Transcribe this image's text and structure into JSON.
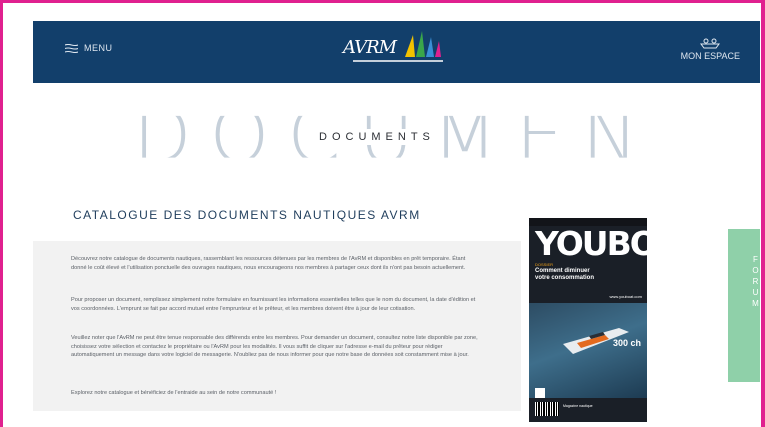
{
  "header": {
    "menu_label": "MENU",
    "logo_text": "AVRM",
    "myspace_label": "MON ESPACE",
    "logo_colors": [
      "#f2c200",
      "#3aa64a",
      "#e0208f",
      "#3a8fd6"
    ]
  },
  "hero": {
    "big_text": "DOCUMENTS",
    "small_text": "DOCUMENTS"
  },
  "section": {
    "title": "CATALOGUE DES DOCUMENTS NAUTIQUES AVRM"
  },
  "content": {
    "paragraphs": [
      "Découvrez notre catalogue de documents nautiques, rassemblant les ressources détenues par les membres de l'AvRM et disponibles en prêt temporaire. Étant donné le coût élevé et l'utilisation ponctuelle des ouvrages nautiques, nous encourageons nos membres à partager ceux dont ils n'ont pas besoin actuellement.",
      "Pour proposer un document, remplissez simplement notre formulaire en fournissant les informations essentielles telles que le nom du document, la date d'édition et vos coordonnées. L'emprunt se fait par accord mutuel entre l'emprunteur et le prêteur, et les membres doivent être à jour de leur cotisation.",
      "Veuillez noter que l'AvRM ne peut être tenue responsable des différends entre les membres. Pour demander un document, consultez notre liste disponible par zone, choisissez votre sélection et contactez le propriétaire ou l'AvRM pour les modalités. Il vous suffit de cliquer sur l'adresse e-mail du prêteur pour rédiger automatiquement un message dans votre logiciel de messagerie. N'oubliez pas de nous informer pour que notre base de données soit constamment mise à jour.",
      "Explorez notre catalogue et bénéficiez de l'entraide au sein de notre communauté !"
    ]
  },
  "magazine": {
    "title": "YOUBOAT",
    "tag": "DOSSIER",
    "headline": "Comment diminuer votre consommation",
    "right_text": "www.youboat.com",
    "power": "300 ch",
    "footer": "Magazine nautique"
  },
  "forum": {
    "label": "FORUM"
  },
  "colors": {
    "header_bg": "#123f6b",
    "frame": "#e0208f",
    "forum_bg": "#8fd0a9"
  }
}
